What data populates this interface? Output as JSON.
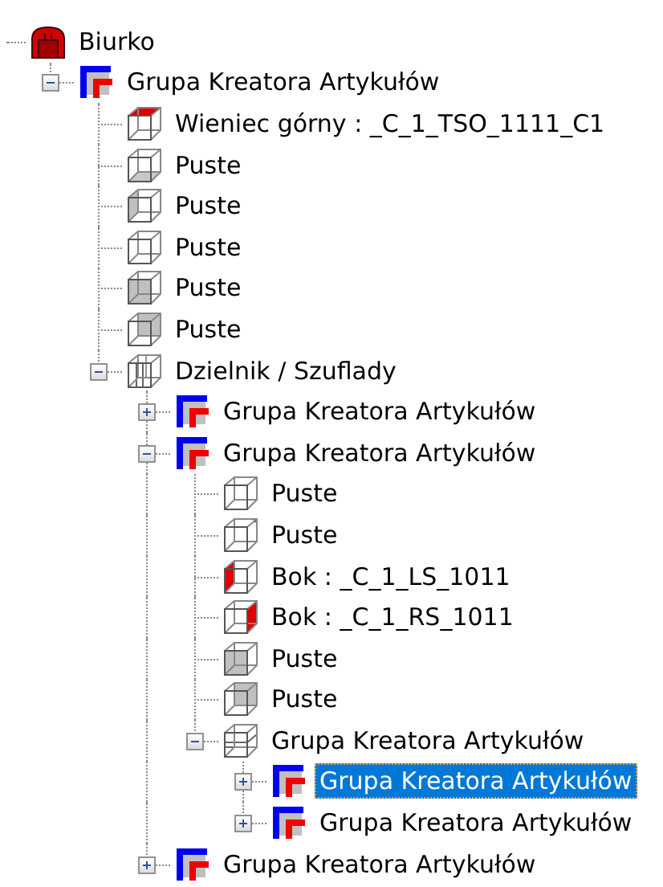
{
  "tree": {
    "nodes": [
      {
        "label": "Biurko",
        "kind": "desk",
        "selected": false,
        "children": [
          {
            "label": "Grupa Kreatora Artykułów",
            "kind": "group",
            "selected": false,
            "expanded": true,
            "children": [
              {
                "label": "Wieniec górny : _C_1_TSO_1111_C1",
                "kind": "cube-top",
                "selected": false
              },
              {
                "label": "Puste",
                "kind": "cube-bottom",
                "selected": false
              },
              {
                "label": "Puste",
                "kind": "cube-left",
                "selected": false
              },
              {
                "label": "Puste",
                "kind": "cube-plain",
                "selected": false
              },
              {
                "label": "Puste",
                "kind": "cube-front",
                "selected": false
              },
              {
                "label": "Puste",
                "kind": "cube-back",
                "selected": false
              },
              {
                "label": "Dzielnik / Szuflady",
                "kind": "cube-divided",
                "selected": false,
                "expanded": true,
                "children": [
                  {
                    "label": "Grupa Kreatora Artykułów",
                    "kind": "group",
                    "selected": false,
                    "expanded": false
                  },
                  {
                    "label": "Grupa Kreatora Artykułów",
                    "kind": "group",
                    "selected": false,
                    "expanded": true,
                    "children": [
                      {
                        "label": "Puste",
                        "kind": "cube-plain",
                        "selected": false
                      },
                      {
                        "label": "Puste",
                        "kind": "cube-mark",
                        "selected": false
                      },
                      {
                        "label": "Bok : _C_1_LS_1011",
                        "kind": "cube-left-red",
                        "selected": false
                      },
                      {
                        "label": "Bok : _C_1_RS_1011",
                        "kind": "cube-right-red",
                        "selected": false
                      },
                      {
                        "label": "Puste",
                        "kind": "cube-front",
                        "selected": false
                      },
                      {
                        "label": "Puste",
                        "kind": "cube-back",
                        "selected": false
                      },
                      {
                        "label": "Grupa Kreatora Artykułów",
                        "kind": "cube-shelves",
                        "selected": false,
                        "expanded": true,
                        "children": [
                          {
                            "label": "Grupa Kreatora Artykułów",
                            "kind": "group",
                            "selected": true,
                            "expanded": false
                          },
                          {
                            "label": "Grupa Kreatora Artykułów",
                            "kind": "group",
                            "selected": false,
                            "expanded": false
                          }
                        ]
                      }
                    ]
                  },
                  {
                    "label": "Grupa Kreatora Artykułów",
                    "kind": "group",
                    "selected": false,
                    "expanded": false
                  }
                ]
              }
            ]
          }
        ]
      }
    ]
  }
}
